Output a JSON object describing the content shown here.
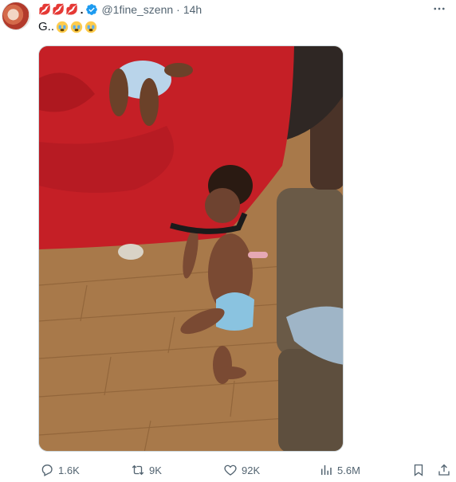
{
  "tweet": {
    "name_emojis": "💋💋💋",
    "name_suffix": ".",
    "handle": "@1fine_szenn",
    "separator": "·",
    "time": "14h",
    "text": "G.."
  },
  "icons": {
    "avatar": "avatar-image",
    "verified": "verified-badge-icon",
    "more": "more-options-icon",
    "reply": "reply-icon",
    "retweet": "retweet-icon",
    "like": "heart-icon",
    "views": "views-chart-icon",
    "bookmark": "bookmark-icon",
    "share": "share-icon",
    "text_emoji": "crying-face-emoji"
  },
  "actions": {
    "replies": "1.6K",
    "retweets": "9K",
    "likes": "92K",
    "views": "5.6M"
  },
  "colors": {
    "accent": "#1d9bf0",
    "secondary_text": "#536471",
    "primary_text": "#0f1419"
  }
}
